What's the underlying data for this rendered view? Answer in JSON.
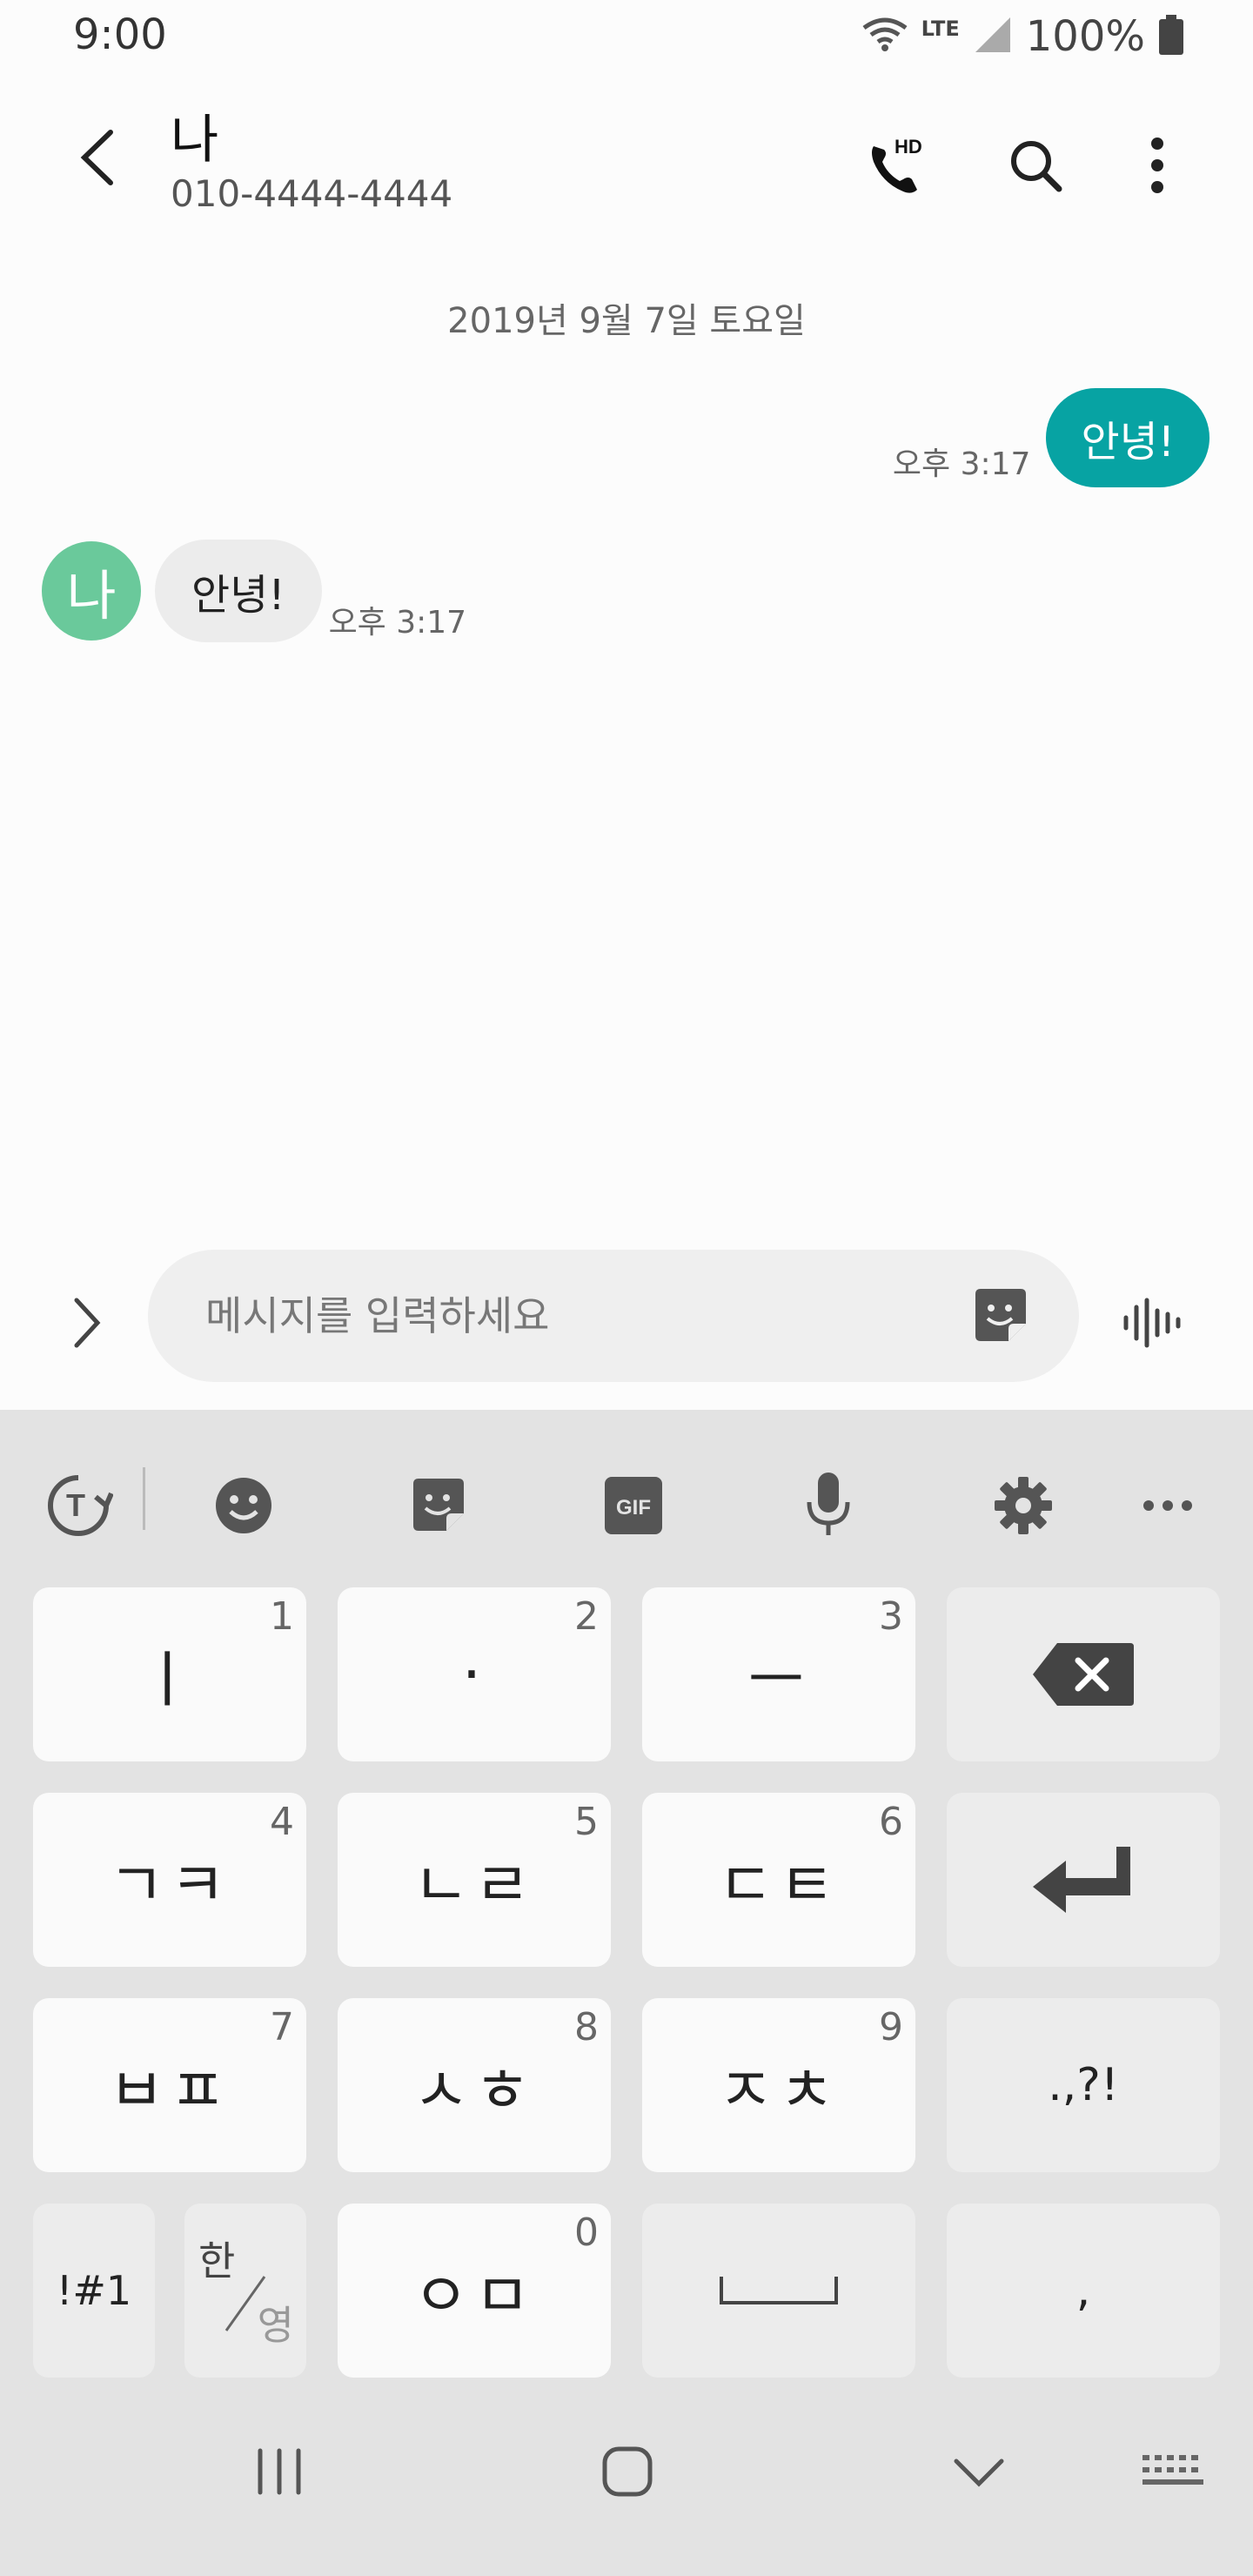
{
  "status_bar": {
    "time": "9:00",
    "network": "LTE",
    "battery": "100%"
  },
  "header": {
    "contact_name": "나",
    "contact_number": "010-4444-4444",
    "icons": [
      "back-icon",
      "hd-call-icon",
      "search-icon",
      "more-icon"
    ]
  },
  "conversation": {
    "date": "2019년 9월 7일 토요일",
    "sent": {
      "text": "안녕!",
      "time": "오후 3:17"
    },
    "received": {
      "avatar_letter": "나",
      "text": "안녕!",
      "time": "오후 3:17"
    },
    "colors": {
      "sent_bubble": "#07a3a3",
      "received_bubble": "#ececec",
      "avatar": "#6ac99b"
    }
  },
  "input": {
    "placeholder": "메시지를 입력하세요",
    "value": ""
  },
  "keyboard": {
    "toolbar": [
      "translate-icon",
      "emoji-icon",
      "sticker-icon",
      "gif-icon",
      "mic-icon",
      "settings-icon",
      "more-icon"
    ],
    "gif_label": "GIF",
    "rows": [
      [
        {
          "label": "ㅣ",
          "num": "1"
        },
        {
          "label": "·",
          "num": "2"
        },
        {
          "label": "ㅡ",
          "num": "3"
        },
        {
          "label": "backspace"
        }
      ],
      [
        {
          "label": "ㄱㅋ",
          "num": "4"
        },
        {
          "label": "ㄴㄹ",
          "num": "5"
        },
        {
          "label": "ㄷㅌ",
          "num": "6"
        },
        {
          "label": "enter"
        }
      ],
      [
        {
          "label": "ㅂㅍ",
          "num": "7"
        },
        {
          "label": "ㅅㅎ",
          "num": "8"
        },
        {
          "label": "ㅈㅊ",
          "num": "9"
        },
        {
          "label": ".,?!"
        }
      ],
      [
        {
          "label": "!#1"
        },
        {
          "label_top": "한",
          "label_bottom": "영"
        },
        {
          "label": "ㅇㅁ",
          "num": "0"
        },
        {
          "label": "space"
        },
        {
          "label": ","
        }
      ]
    ]
  },
  "nav_bar": {
    "icons": [
      "recents-icon",
      "home-icon",
      "back-down-icon",
      "keyboard-switch-icon"
    ]
  }
}
